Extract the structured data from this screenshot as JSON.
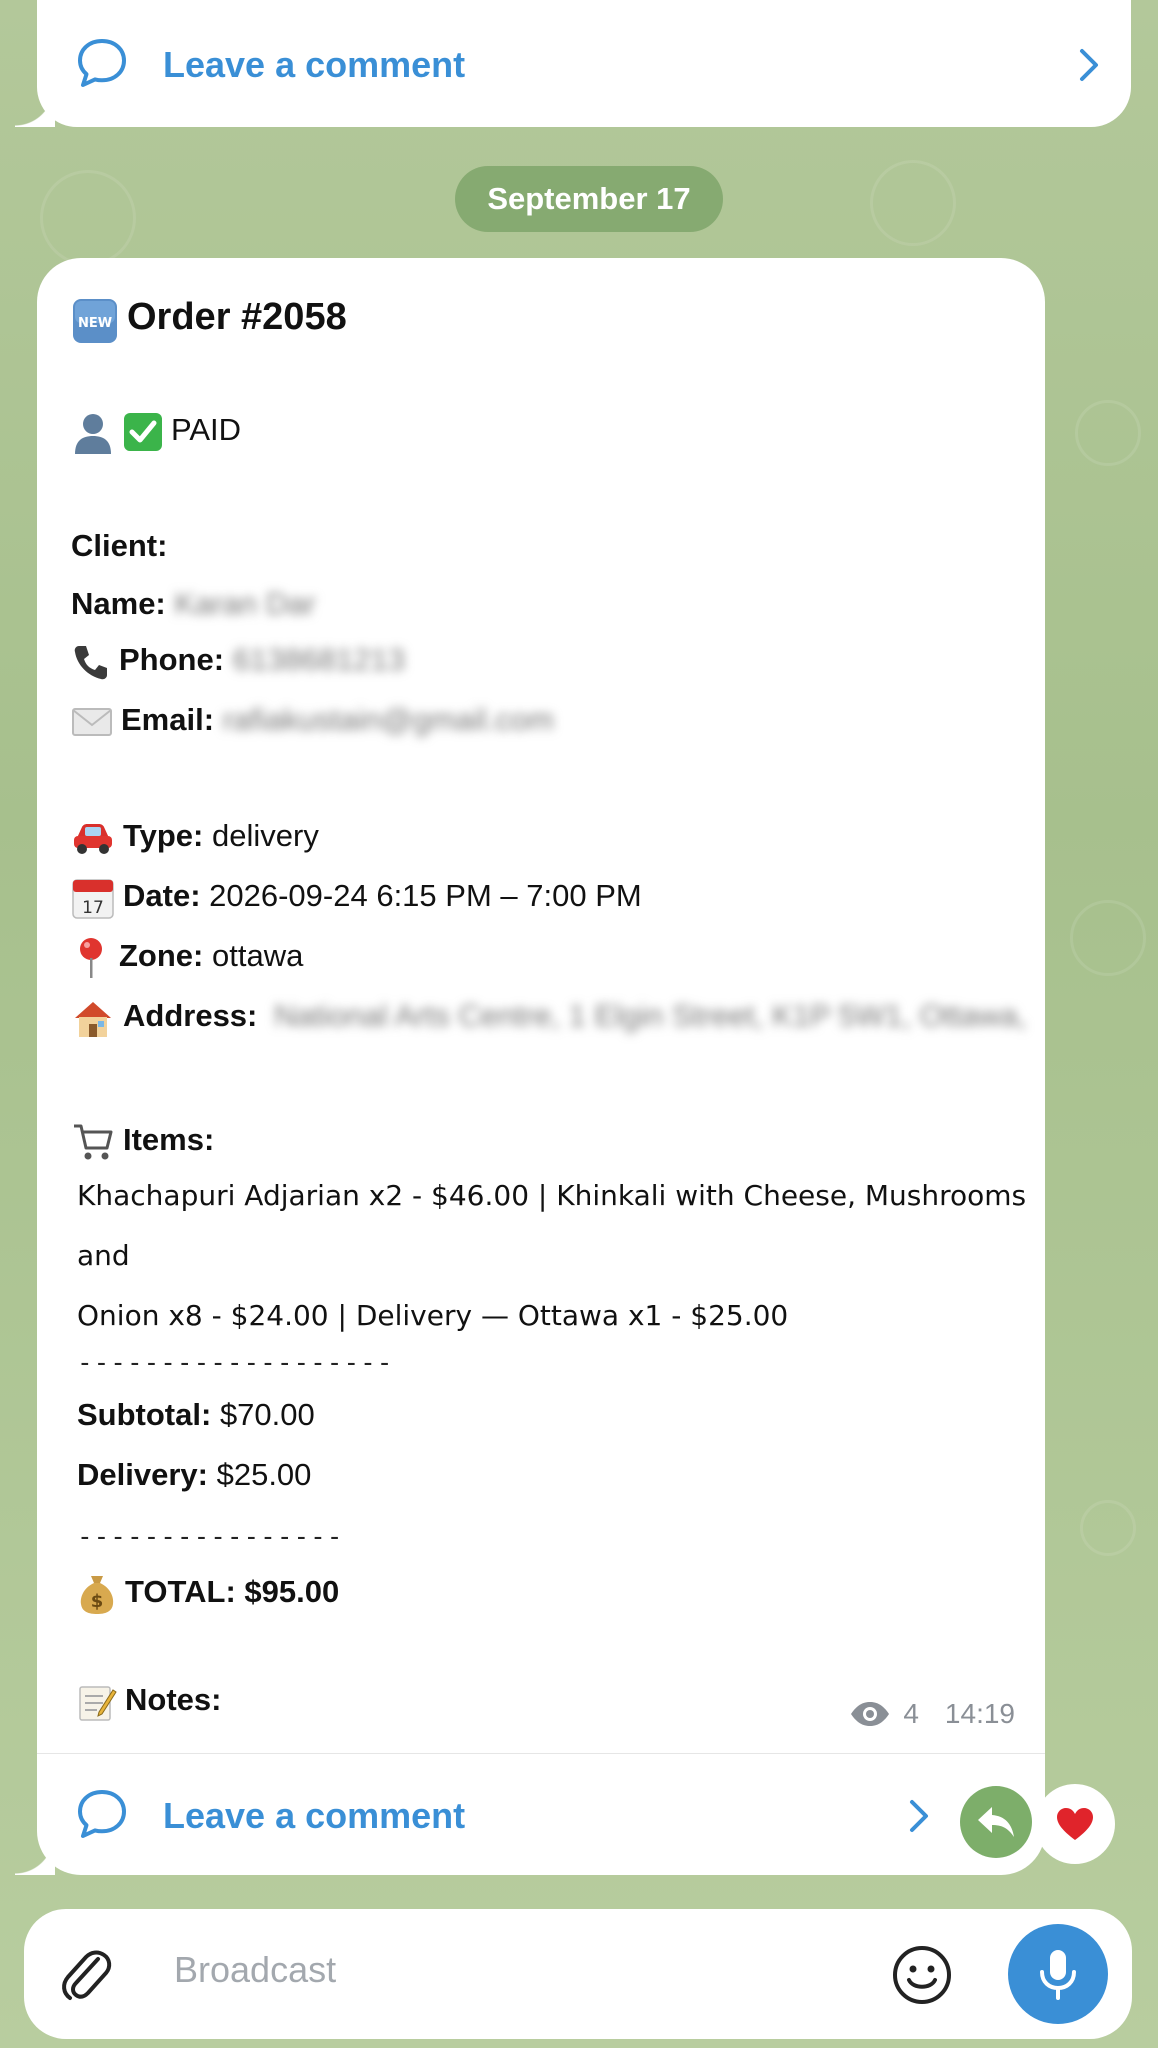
{
  "top_comment": {
    "label": "Leave a comment"
  },
  "date_separator": "September 17",
  "message": {
    "title": "Order #2058",
    "status": "PAID",
    "client_label": "Client:",
    "name_label": "Name:",
    "name_value": "Karan Dar",
    "phone_label": "Phone:",
    "phone_value": "6138681213",
    "email_label": "Email:",
    "email_value": "rafiakustain@gmail.com",
    "type_label": "Type:",
    "type_value": "delivery",
    "date_label": "Date:",
    "date_value": "2026-09-24 6:15 PM – 7:00 PM",
    "zone_label": "Zone:",
    "zone_value": "ottawa",
    "address_label": "Address:",
    "address_value": "National Arts Centre, 1 Elgin Street, K1P 5W1, Ottawa,",
    "items_label": "Items:",
    "items_line1": "Khachapuri Adjarian x2 - $46.00 | Khinkali with Cheese, Mushrooms and",
    "items_line2": "Onion x8 - $24.00 | Delivery — Ottawa x1 - $25.00",
    "separator1": "-------------------",
    "subtotal_label": "Subtotal:",
    "subtotal_value": "$70.00",
    "delivery_label": "Delivery:",
    "delivery_value": "$25.00",
    "separator2": "----------------",
    "total_label": "TOTAL: $95.00",
    "notes_label": "Notes:",
    "views": "4",
    "time": "14:19",
    "comment_label": "Leave a comment",
    "calendar_day": "17"
  },
  "composer": {
    "placeholder": "Broadcast"
  },
  "colors": {
    "accent": "#3a8fd6",
    "share_green": "#7dae6a",
    "heart": "#e0242b"
  },
  "icons": [
    "comment-icon",
    "chevron-right-icon",
    "new-icon",
    "person-icon",
    "check-icon",
    "phone-icon",
    "envelope-icon",
    "car-icon",
    "calendar-icon",
    "pin-icon",
    "house-icon",
    "cart-icon",
    "money-bag-icon",
    "memo-icon",
    "eye-icon",
    "share-icon",
    "heart-icon",
    "paperclip-icon",
    "smiley-icon",
    "microphone-icon"
  ]
}
